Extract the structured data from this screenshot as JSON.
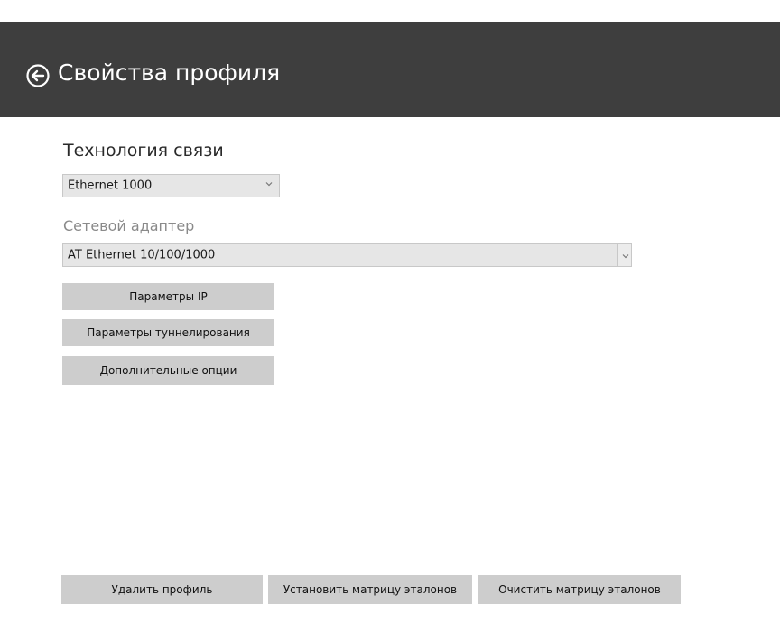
{
  "header": {
    "title": "Свойства профиля",
    "back_icon": "arrow-left-circle-icon"
  },
  "technology": {
    "label": "Технология связи",
    "selected": "Ethernet 1000"
  },
  "adapter": {
    "label": "Сетевой адаптер",
    "selected": "AT Ethernet 10/100/1000"
  },
  "buttons": {
    "ip": "Параметры IP",
    "tunnel": "Параметры туннелирования",
    "extra": "Дополнительные опции"
  },
  "footer": {
    "delete": "Удалить профиль",
    "set_matrix": "Установить матрицу эталонов",
    "clear_matrix": "Очистить матрицу эталонов"
  },
  "colors": {
    "header_bg": "#3e3e3e",
    "button_bg": "#cdcdcd",
    "dropdown_bg": "#e6e6e6"
  }
}
